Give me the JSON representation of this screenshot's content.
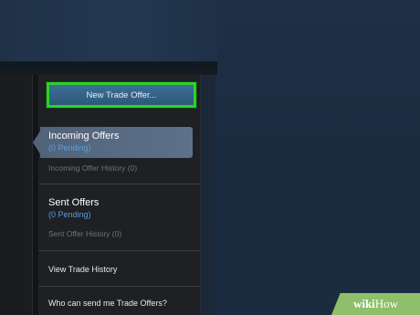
{
  "sidebar": {
    "new_offer_label": "New Trade Offer...",
    "incoming": {
      "title": "Incoming Offers",
      "pending": "(0 Pending)",
      "history": "Incoming Offer History (0)"
    },
    "sent": {
      "title": "Sent Offers",
      "pending": "(0 Pending)",
      "history": "Sent Offer History (0)"
    },
    "view_history": "View Trade History",
    "who_can_send": "Who can send me Trade Offers?"
  },
  "watermark": {
    "wiki": "wiki",
    "how": "How"
  },
  "colors": {
    "highlight": "#2bd22b",
    "button": "#3d6f96",
    "pending": "#5a9ee0",
    "background": "#1b2838"
  }
}
